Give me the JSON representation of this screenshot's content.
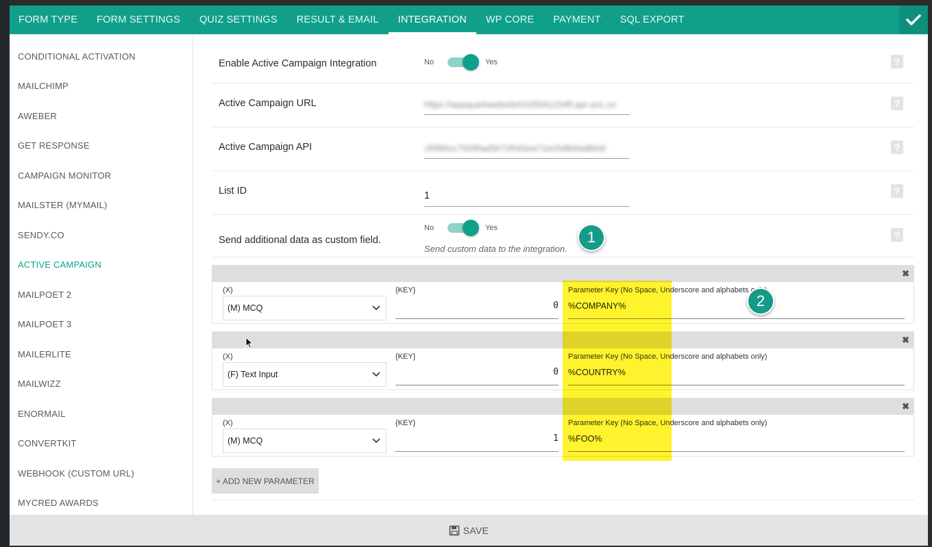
{
  "tabs": [
    {
      "label": "FORM TYPE"
    },
    {
      "label": "FORM SETTINGS"
    },
    {
      "label": "QUIZ SETTINGS"
    },
    {
      "label": "RESULT & EMAIL"
    },
    {
      "label": "INTEGRATION",
      "active": true
    },
    {
      "label": "WP CORE"
    },
    {
      "label": "PAYMENT"
    },
    {
      "label": "SQL EXPORT"
    }
  ],
  "sidebar": {
    "items": [
      {
        "label": "CONDITIONAL ACTIVATION"
      },
      {
        "label": "MAILCHIMP"
      },
      {
        "label": "AWEBER"
      },
      {
        "label": "GET RESPONSE"
      },
      {
        "label": "CAMPAIGN MONITOR"
      },
      {
        "label": "MAILSTER (MYMAIL)"
      },
      {
        "label": "SENDY.CO"
      },
      {
        "label": "ACTIVE CAMPAIGN",
        "active": true
      },
      {
        "label": "MAILPOET 2"
      },
      {
        "label": "MAILPOET 3"
      },
      {
        "label": "MAILERLITE"
      },
      {
        "label": "MAILWIZZ"
      },
      {
        "label": "ENORMAIL"
      },
      {
        "label": "CONVERTKIT"
      },
      {
        "label": "WEBHOOK (CUSTOM URL)"
      },
      {
        "label": "MYCRED AWARDS"
      }
    ]
  },
  "settings": {
    "enable": {
      "label": "Enable Active Campaign Integration",
      "no": "No",
      "yes": "Yes"
    },
    "url": {
      "label": "Active Campaign URL",
      "value": "https://appquarkwebsite0100041234fl.api-us1.co"
    },
    "api": {
      "label": "Active Campaign API",
      "value": "cf0f90cc7928faa5b71f0d3ea71ec5d8d4a8b0d"
    },
    "list": {
      "label": "List ID",
      "value": "1"
    },
    "custom": {
      "label": "Send additional data as custom field.",
      "no": "No",
      "yes": "Yes",
      "hint": "Send custom data to the integration."
    }
  },
  "params": {
    "x_label": "(X)",
    "key_label": "{KEY}",
    "param_label": "Parameter Key (No Space, Underscore and alphabets only)",
    "rows": [
      {
        "x": "(M) MCQ",
        "key": "0",
        "param": "%COMPANY%"
      },
      {
        "x": "(F) Text Input",
        "key": "0",
        "param": "%COUNTRY%"
      },
      {
        "x": "(M) MCQ",
        "key": "1",
        "param": "%FOO%"
      }
    ]
  },
  "add_button": "+ ADD NEW PARAMETER",
  "save_button": "SAVE",
  "help_glyph": "?",
  "close_glyph": "✖",
  "markers": [
    "1",
    "2"
  ],
  "colors": {
    "accent": "#10a08a",
    "highlight": "#fff000"
  }
}
